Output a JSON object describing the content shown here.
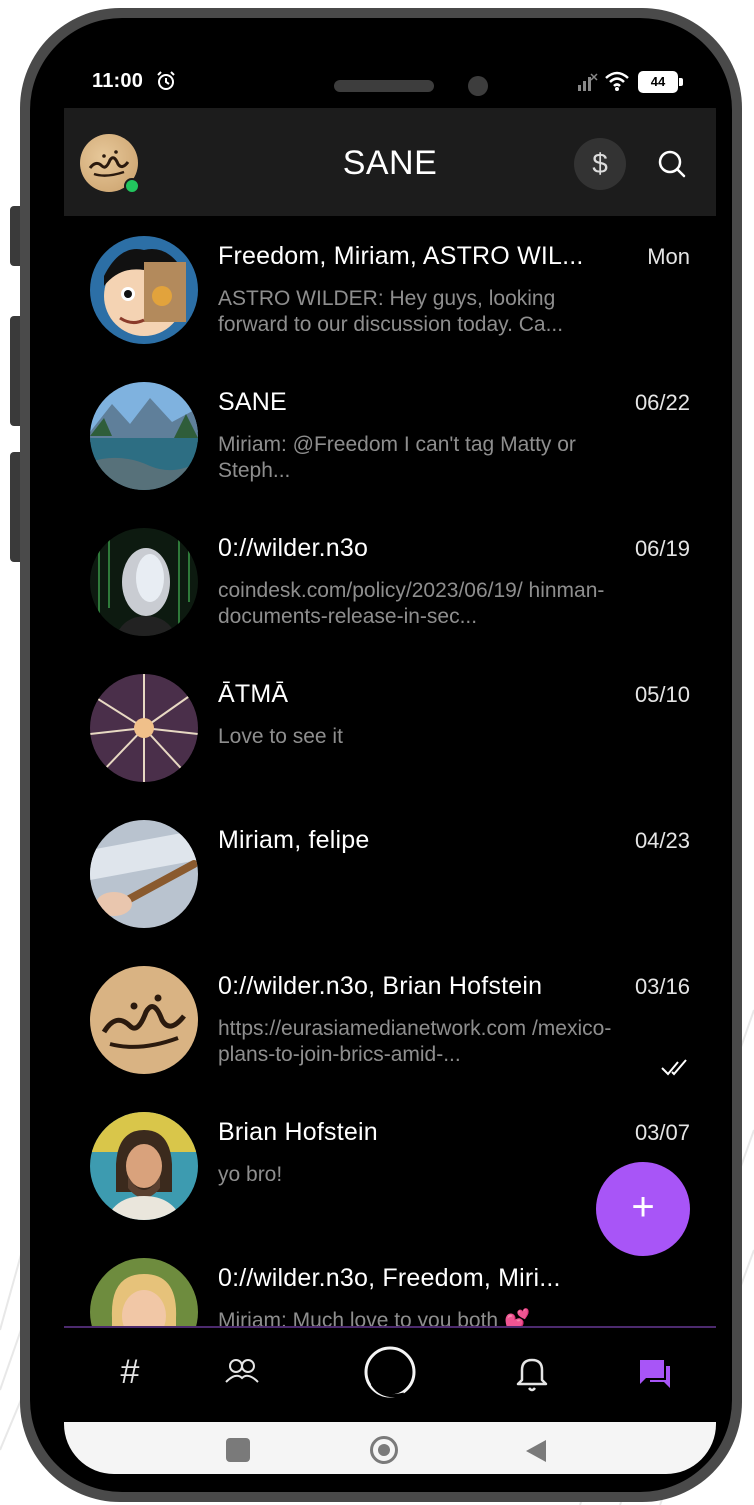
{
  "status_bar": {
    "time": "11:00",
    "battery": "44"
  },
  "header": {
    "title": "SANE",
    "dollar_label": "$"
  },
  "conversations": [
    {
      "title": "Freedom, Miriam, ASTRO WIL...",
      "date": "Mon",
      "preview": "ASTRO WILDER: Hey guys, looking forward to our discussion today. Ca...",
      "read": false
    },
    {
      "title": "SANE",
      "date": "06/22",
      "preview": "Miriam: @Freedom  I can't tag Matty or Steph...",
      "read": false
    },
    {
      "title": "0://wilder.n3o",
      "date": "06/19",
      "preview": "coindesk.com/policy/2023/06/19/ hinman-documents-release-in-sec...",
      "read": false
    },
    {
      "title": "ĀTMĀ",
      "date": "05/10",
      "preview": "Love to see it",
      "read": false
    },
    {
      "title": "Miriam, felipe",
      "date": "04/23",
      "preview": "",
      "read": false
    },
    {
      "title": "0://wilder.n3o, Brian Hofstein",
      "date": "03/16",
      "preview": "https://eurasiamedianetwork.com /mexico-plans-to-join-brics-amid-...",
      "read": true
    },
    {
      "title": "Brian Hofstein",
      "date": "03/07",
      "preview": "yo bro!",
      "read": true
    },
    {
      "title": "0://wilder.n3o, Freedom, Miri...",
      "date": "",
      "preview": "Miriam: Much love to you both 💕",
      "read": false
    }
  ],
  "fab": {
    "label": "+"
  },
  "bottom_nav": {
    "items": [
      {
        "icon": "hash-icon",
        "label": "#"
      },
      {
        "icon": "community-icon"
      },
      {
        "icon": "home-ring-icon"
      },
      {
        "icon": "bell-icon"
      },
      {
        "icon": "chat-icon",
        "active": true
      }
    ]
  },
  "colors": {
    "accent": "#a855f7",
    "header_bg": "#1c1c1c",
    "online": "#22c55e"
  }
}
